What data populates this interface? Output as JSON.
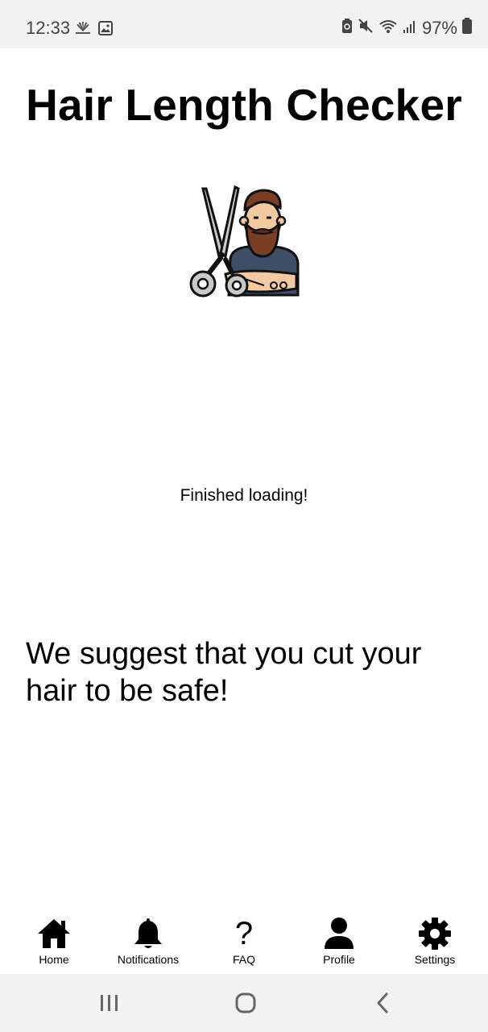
{
  "status_bar": {
    "time": "12:33",
    "battery_percent": "97%",
    "left_icons": [
      "nbc-icon",
      "gallery-icon"
    ],
    "right_icons": [
      "battery-saver-icon",
      "mute-icon",
      "wifi-icon",
      "signal-icon",
      "battery-icon"
    ]
  },
  "app": {
    "title": "Hair Length Checker",
    "hero_icon": "barber-scissors-icon",
    "loading_text": "Finished loading!",
    "suggestion": "We suggest that you cut your hair to be safe!"
  },
  "bottom_nav": {
    "items": [
      {
        "label": "Home",
        "icon": "home-icon"
      },
      {
        "label": "Notifications",
        "icon": "bell-icon"
      },
      {
        "label": "FAQ",
        "icon": "question-icon",
        "glyph": "?"
      },
      {
        "label": "Profile",
        "icon": "person-icon"
      },
      {
        "label": "Settings",
        "icon": "gear-icon"
      }
    ]
  },
  "system_nav": {
    "buttons": [
      "recents-icon",
      "home-circle-icon",
      "back-icon"
    ]
  },
  "colors": {
    "status_bar_bg": "#f2f2f2",
    "text": "#000000",
    "status_text": "#444444"
  }
}
